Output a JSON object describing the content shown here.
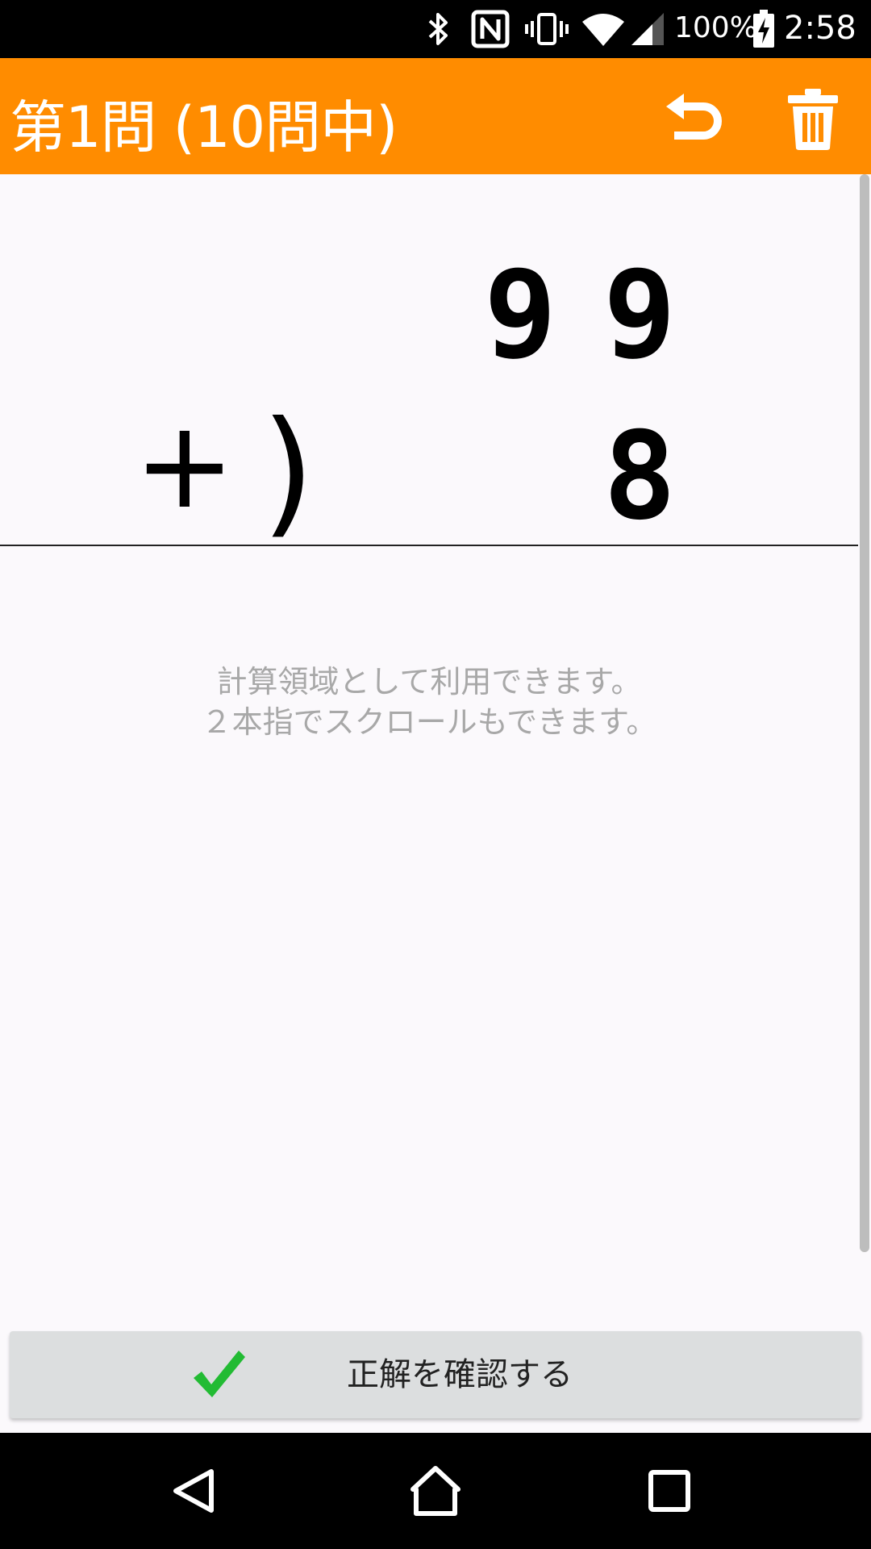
{
  "status_bar": {
    "battery_percent": "100%",
    "time": "2:58",
    "icons": [
      "bluetooth-icon",
      "nfc-icon",
      "vibrate-icon",
      "wifi-icon",
      "cell-signal-icon",
      "battery-charging-icon"
    ]
  },
  "app_bar": {
    "title": "第1問 (10問中)",
    "actions": [
      "undo-icon",
      "trash-icon"
    ],
    "color": "#ff8c00"
  },
  "problem": {
    "top_digits": [
      "9",
      "9"
    ],
    "operator": "+",
    "paren": ")",
    "bottom_digits": [
      "8"
    ]
  },
  "workspace": {
    "hint_line1": "計算領域として利用できます。",
    "hint_line2": "２本指でスクロールもできます。"
  },
  "check_button": {
    "label": "正解を確認する",
    "icon": "checkmark-icon",
    "icon_color": "#22bb33"
  },
  "nav_bar": {
    "buttons": [
      "back-icon",
      "home-icon",
      "recents-icon"
    ]
  }
}
